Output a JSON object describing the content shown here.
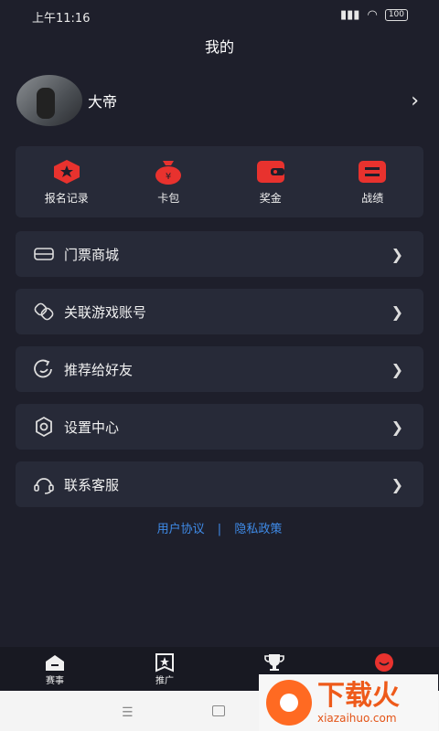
{
  "status": {
    "time": "上午11:16",
    "battery": "100"
  },
  "header": {
    "title": "我的"
  },
  "profile": {
    "name": "大帝"
  },
  "quick_actions": [
    {
      "label": "报名记录",
      "icon": "badge-star-icon"
    },
    {
      "label": "卡包",
      "icon": "money-bag-icon"
    },
    {
      "label": "奖金",
      "icon": "wallet-icon"
    },
    {
      "label": "战绩",
      "icon": "record-icon"
    }
  ],
  "menu": [
    {
      "label": "门票商城",
      "icon": "ticket-icon"
    },
    {
      "label": "关联游戏账号",
      "icon": "link-icon"
    },
    {
      "label": "推荐给好友",
      "icon": "share-icon"
    },
    {
      "label": "设置中心",
      "icon": "gear-icon"
    },
    {
      "label": "联系客服",
      "icon": "headset-icon"
    }
  ],
  "links": {
    "user_agreement": "用户协议",
    "separator": "|",
    "privacy": "隐私政策"
  },
  "tabs": [
    {
      "label": "赛事"
    },
    {
      "label": "推广"
    },
    {
      "label": ""
    },
    {
      "label": ""
    }
  ],
  "watermark": {
    "cn": "下载火",
    "en": "xiazaihuo.com"
  },
  "colors": {
    "accent": "#e8322e",
    "link": "#3f8be8",
    "background": "#1e1f2b",
    "card": "#272a38"
  }
}
